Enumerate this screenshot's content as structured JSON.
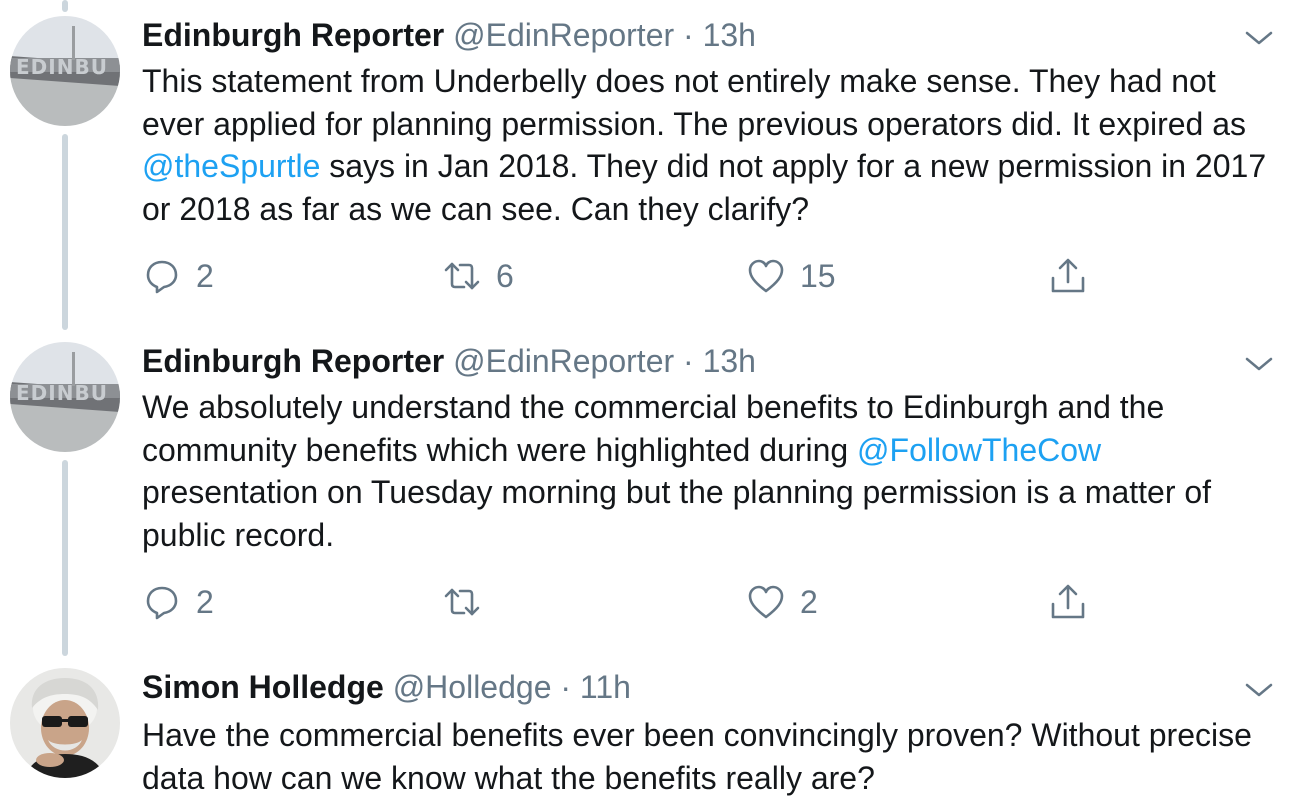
{
  "tweets": [
    {
      "name": "Edinburgh Reporter",
      "handle": "@EdinReporter",
      "dot": "·",
      "time": "13h",
      "text_parts": [
        "This statement from Underbelly does not entirely make sense. They had not ever applied for planning permission. The previous operators did. It expired as ",
        "@theSpurtle",
        " says in Jan 2018. They did not apply for a new permission in 2017 or 2018 as far as we can see. Can they clarify?"
      ],
      "replies": "2",
      "retweets": "6",
      "likes": "15"
    },
    {
      "name": "Edinburgh Reporter",
      "handle": "@EdinReporter",
      "dot": "·",
      "time": "13h",
      "text_parts": [
        "We absolutely understand the commercial benefits to Edinburgh and the community benefits which were highlighted during ",
        "@FollowTheCow",
        " presentation on Tuesday morning but the planning permission is a matter of public record."
      ],
      "replies": "2",
      "retweets": "",
      "likes": "2"
    },
    {
      "name": "Simon Holledge",
      "handle": "@Holledge",
      "dot": "·",
      "time": "11h",
      "text_parts": [
        "Have the commercial benefits ever been convincingly proven? Without precise data how can we know what the benefits really are?"
      ]
    }
  ],
  "icons": {
    "reply": "reply-icon",
    "retweet": "retweet-icon",
    "like": "heart-icon",
    "share": "share-icon",
    "menu": "chevron-down-icon"
  },
  "colors": {
    "text": "#14171a",
    "secondary": "#657786",
    "link": "#1da1f2",
    "thread_line": "#ccd6dd"
  }
}
